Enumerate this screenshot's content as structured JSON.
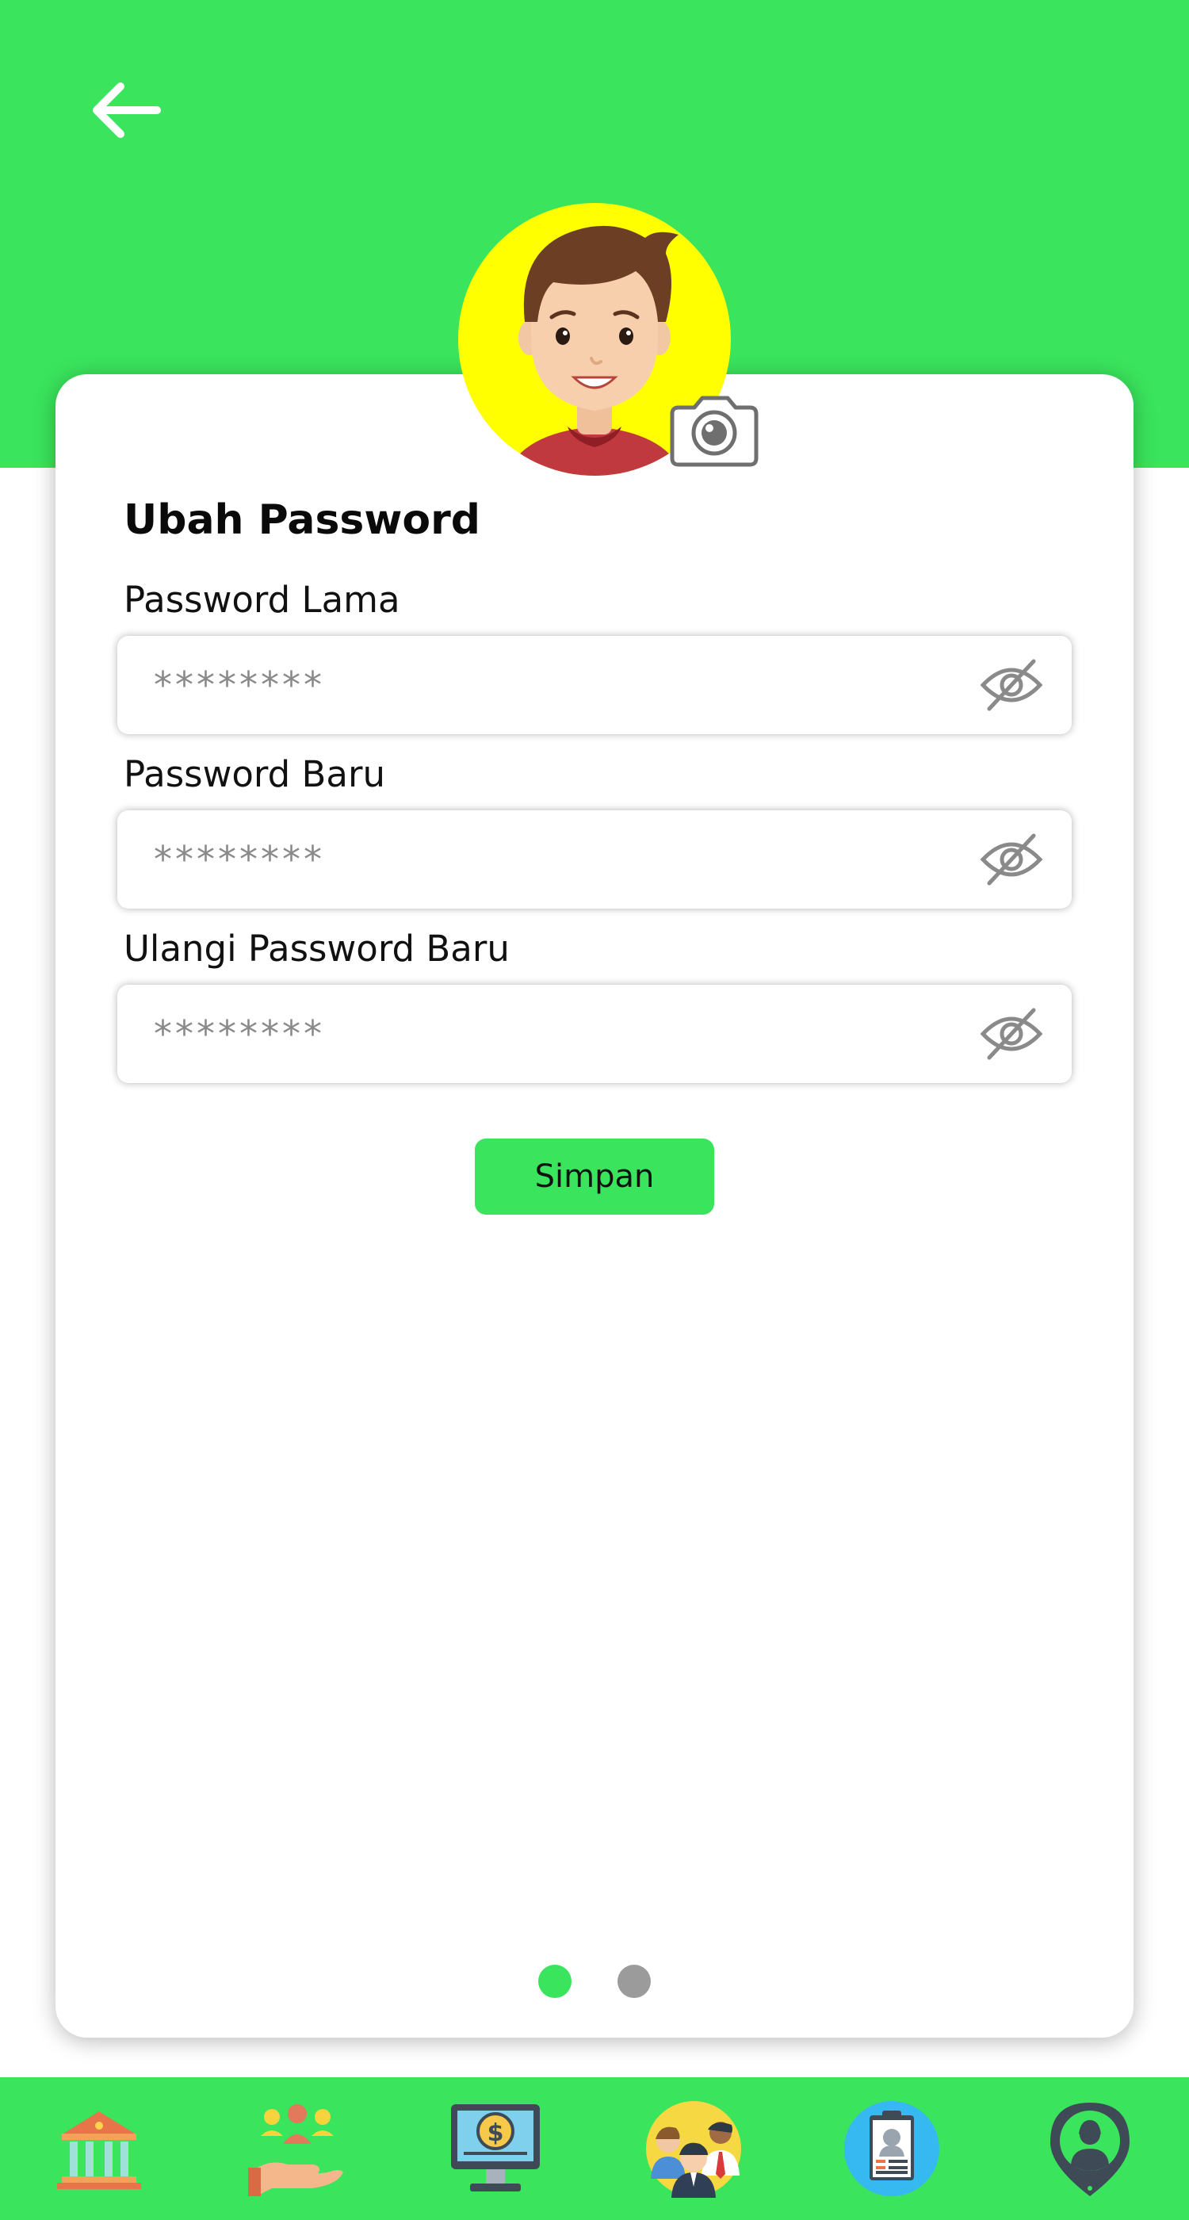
{
  "header": {
    "back_icon": "arrow-left-icon",
    "background_color": "#3ae45c"
  },
  "profile": {
    "avatar_icon": "user-avatar",
    "avatar_background": "#ffff00",
    "camera_icon": "camera-icon"
  },
  "form": {
    "title": "Ubah Password",
    "fields": [
      {
        "label": "Password Lama",
        "placeholder": "********",
        "toggle_icon": "eye-off-icon"
      },
      {
        "label": "Password Baru",
        "placeholder": "********",
        "toggle_icon": "eye-off-icon"
      },
      {
        "label": "Ulangi Password Baru",
        "placeholder": "********",
        "toggle_icon": "eye-off-icon"
      }
    ],
    "save_label": "Simpan"
  },
  "pagination": {
    "total": 2,
    "active": 1,
    "active_color": "#3ae45c",
    "inactive_color": "#9b9b9b"
  },
  "bottom_nav": {
    "items": [
      {
        "icon": "bank-icon"
      },
      {
        "icon": "community-hand-icon"
      },
      {
        "icon": "monitor-dollar-icon"
      },
      {
        "icon": "people-group-icon"
      },
      {
        "icon": "id-card-icon"
      },
      {
        "icon": "location-person-icon"
      }
    ]
  }
}
